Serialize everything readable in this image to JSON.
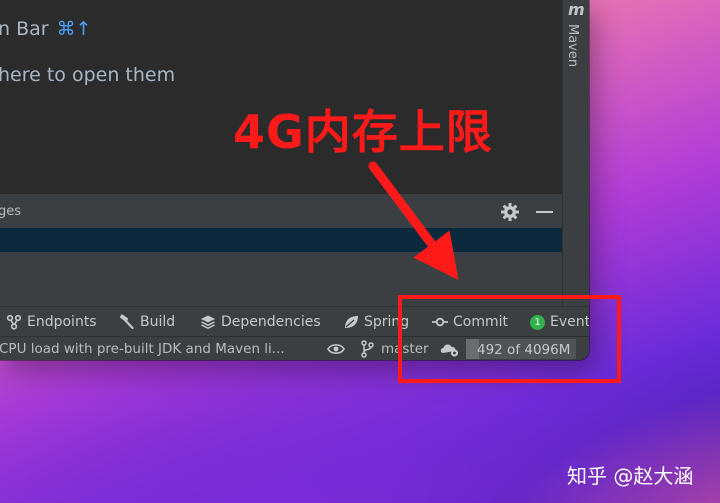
{
  "editor": {
    "hint_line1": "n Bar",
    "hint_line1_shortcut": "⌘↑",
    "hint_line2": "here to open them"
  },
  "right_sidebar": {
    "maven_icon_letter": "m",
    "maven_label": "Maven"
  },
  "bottom_panel": {
    "title_fragment": "ges",
    "settings_icon": "gear-icon",
    "minimize_icon": "minus-icon",
    "selection_color": "#0d293e"
  },
  "tool_windows": [
    {
      "label": "Endpoints",
      "icon": "endpoints-icon"
    },
    {
      "label": "Build",
      "icon": "hammer-icon"
    },
    {
      "label": "Dependencies",
      "icon": "layers-icon"
    },
    {
      "label": "Spring",
      "icon": "spring-leaf-icon"
    },
    {
      "label": "Commit",
      "icon": "commit-icon"
    },
    {
      "label": "Event",
      "icon": "event-log-icon",
      "badge": "1"
    }
  ],
  "status_bar": {
    "message": "CPU load with pre-built JDK and Maven li...",
    "eye_icon": "eye-icon",
    "branch_icon": "git-branch-icon",
    "branch": "master",
    "daemon_icon": "cloud-gear-icon",
    "memory_text": "492 of 4096M",
    "memory_used_fraction": 0.12
  },
  "annotation": {
    "text": "4G内存上限",
    "color": "#ff1a1a"
  },
  "watermark": "知乎 @赵大涵",
  "colors": {
    "ide_background": "#2b2b2b",
    "panel_background": "#3c3f41",
    "shortcut_blue": "#4aa2ff",
    "annotation_red": "#ff1a1a"
  }
}
